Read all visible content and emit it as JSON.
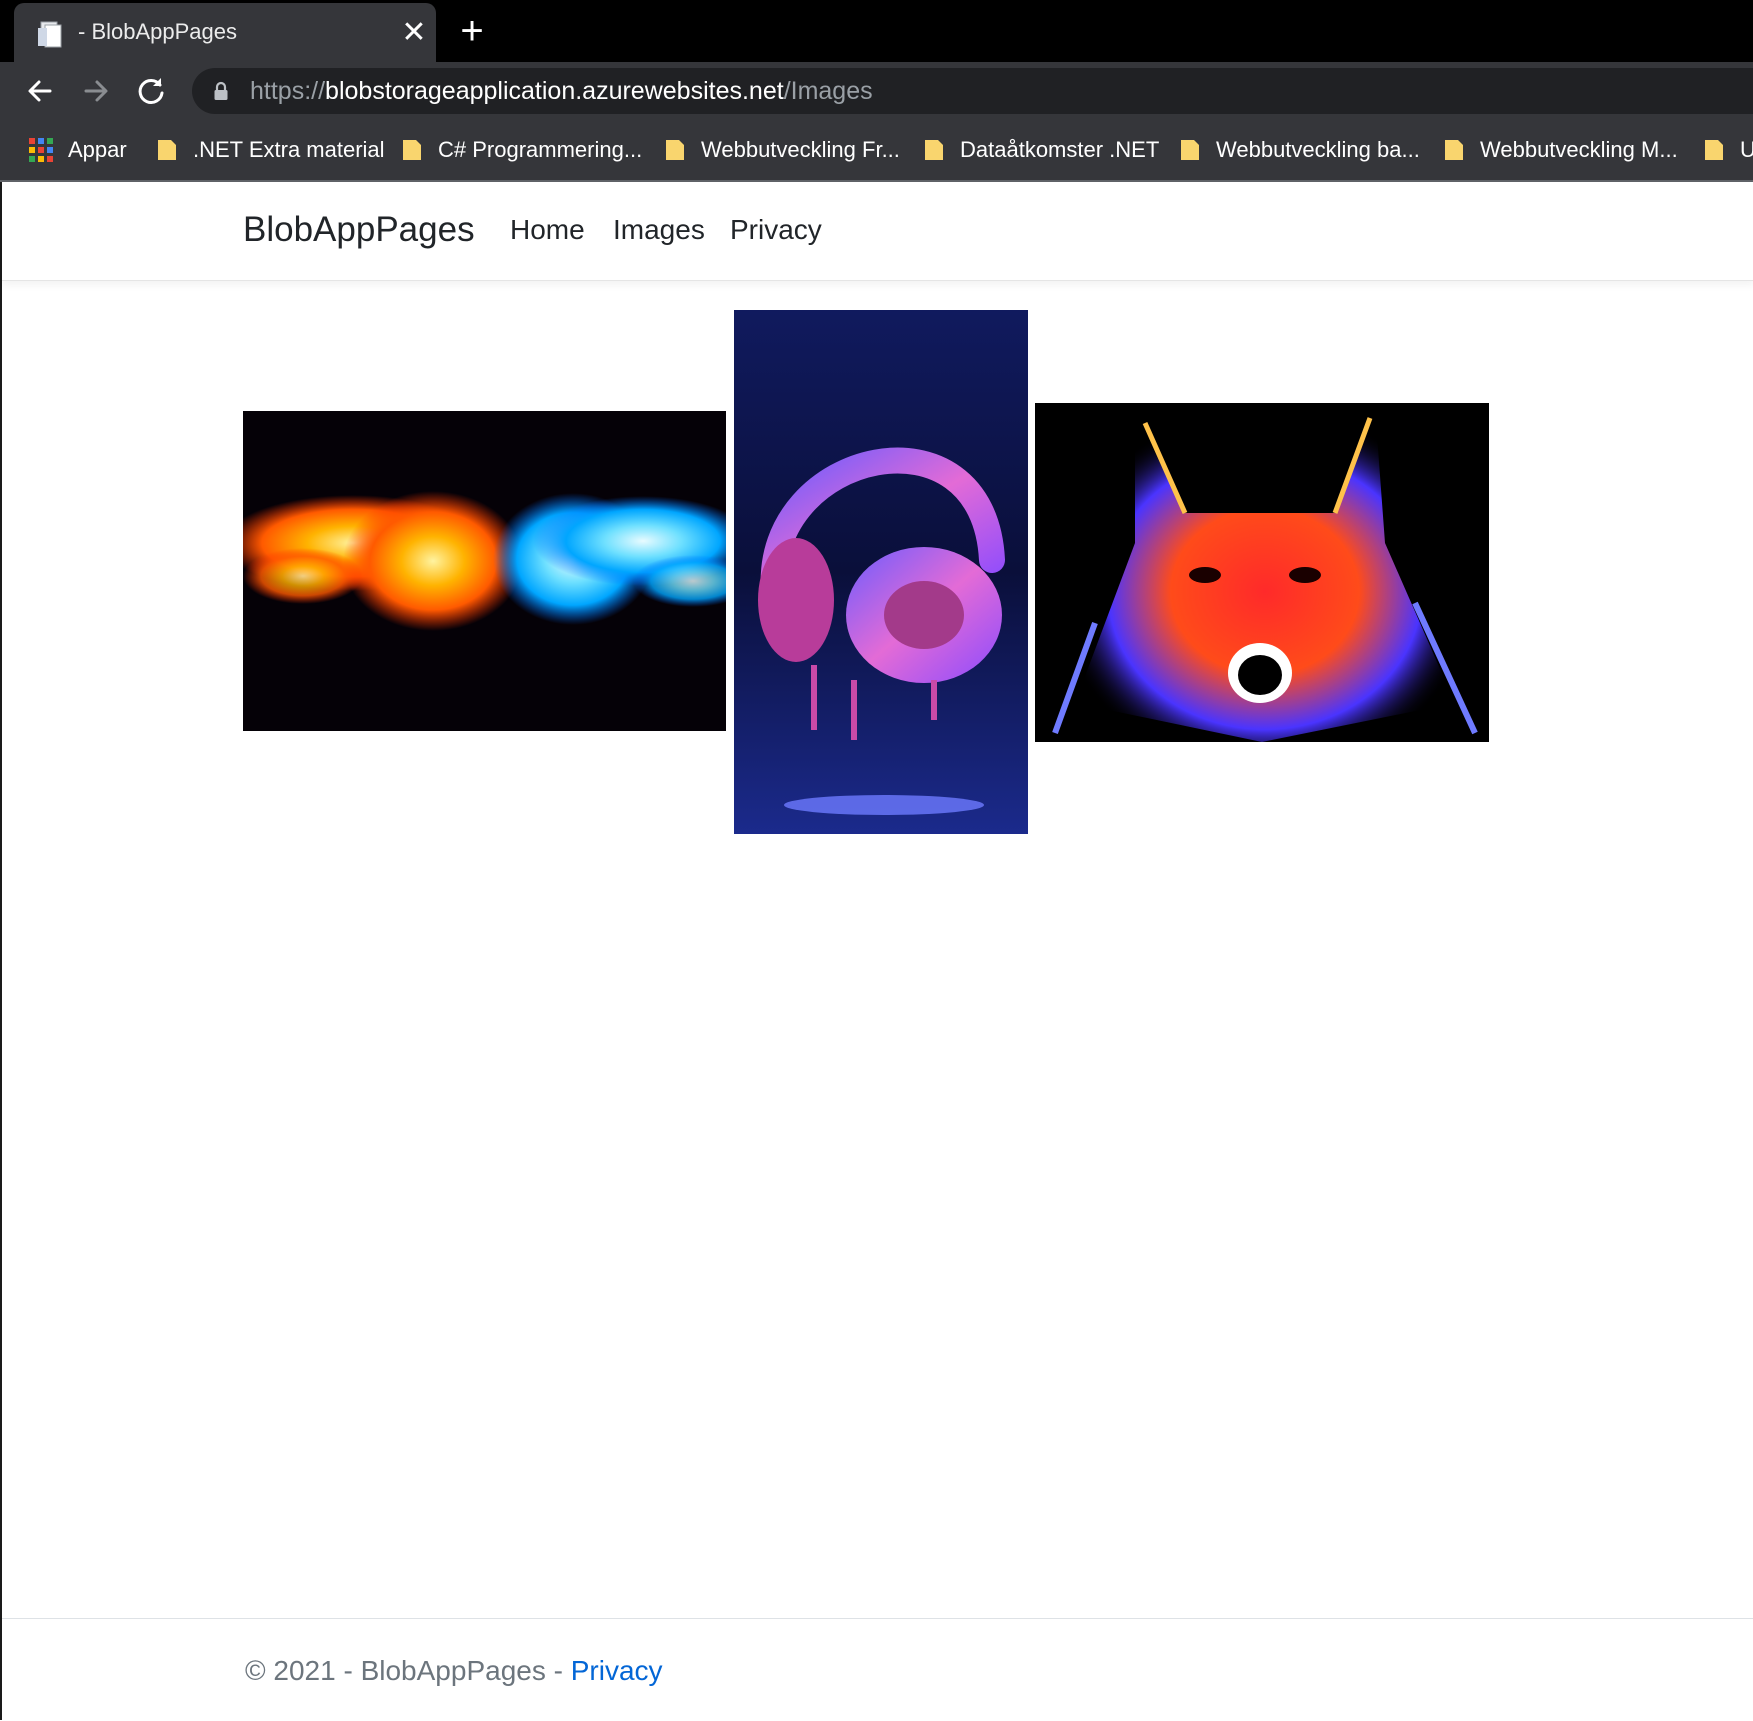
{
  "browser": {
    "tab": {
      "title": "- BlobAppPages",
      "favicon": "document-icon",
      "close_icon": "close-icon"
    },
    "new_tab_icon": "plus-icon",
    "nav": {
      "back_icon": "arrow-left-icon",
      "forward_icon": "arrow-right-icon",
      "reload_icon": "reload-icon"
    },
    "address": {
      "scheme": "https://",
      "host": "blobstorageapplication.azurewebsites.net",
      "path": "/Images"
    },
    "bookmarks": [
      {
        "label": "Appar",
        "icon": "apps-grid-icon"
      },
      {
        "label": ".NET Extra material",
        "icon": "folder-icon"
      },
      {
        "label": "C# Programmering...",
        "icon": "folder-icon"
      },
      {
        "label": "Webbutveckling Fr...",
        "icon": "folder-icon"
      },
      {
        "label": "Dataåtkomster .NET",
        "icon": "folder-icon"
      },
      {
        "label": "Webbutveckling ba...",
        "icon": "folder-icon"
      },
      {
        "label": "Webbutveckling M...",
        "icon": "folder-icon"
      },
      {
        "label": "U",
        "icon": "folder-icon"
      }
    ],
    "colors": {
      "tabstrip": "#000000",
      "toolbar": "#35363a",
      "omnibox": "#202124"
    }
  },
  "site": {
    "brand": "BlobAppPages",
    "nav": [
      {
        "label": "Home"
      },
      {
        "label": "Images"
      },
      {
        "label": "Privacy"
      }
    ],
    "gallery": [
      {
        "subject": "fire-and-ice-fists-image"
      },
      {
        "subject": "melting-headphones-image"
      },
      {
        "subject": "neon-wolf-image"
      }
    ],
    "footer": {
      "text": "© 2021 - BlobAppPages - ",
      "link_label": "Privacy",
      "link_color": "#0366d6"
    }
  }
}
